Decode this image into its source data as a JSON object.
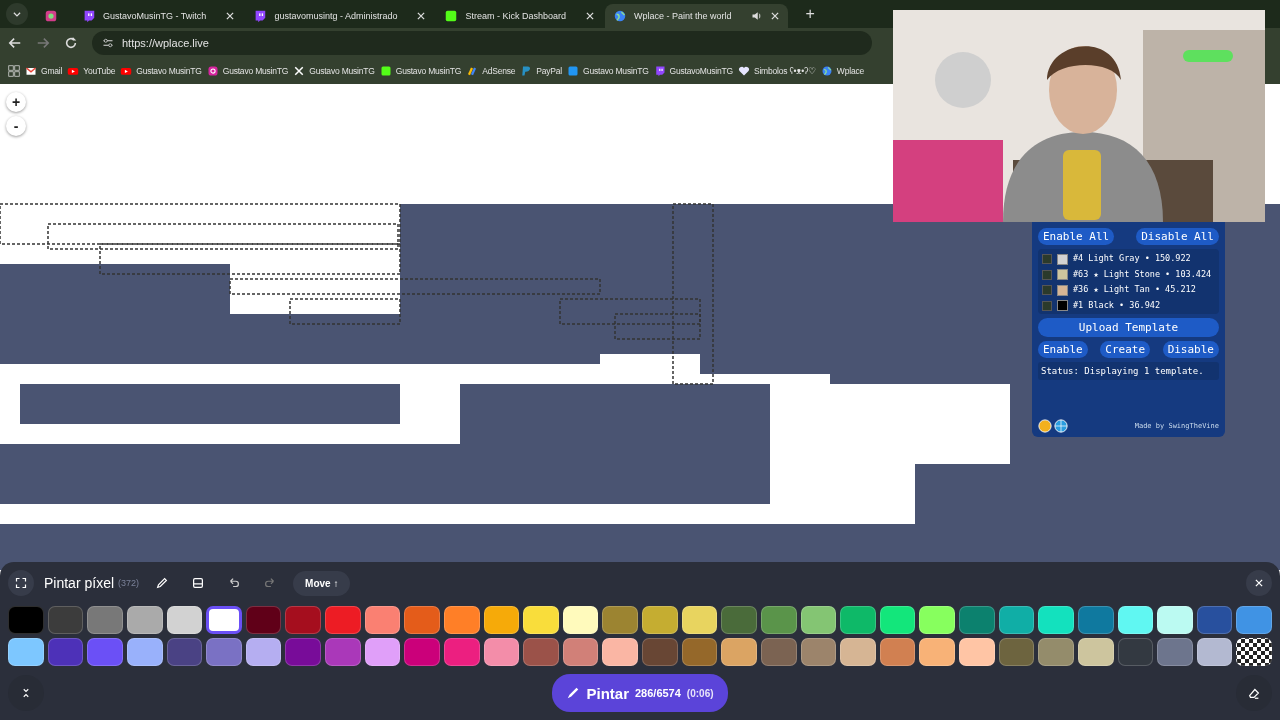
{
  "browser": {
    "tabs": [
      {
        "kind": "app",
        "selected": false
      },
      {
        "label": "GustavoMusinTG - Twitch",
        "kind": "twitch",
        "selected": false
      },
      {
        "label": "gustavomusintg - Administrado",
        "kind": "twitch",
        "selected": false
      },
      {
        "label": "Stream - Kick Dashboard",
        "kind": "kick",
        "selected": false
      },
      {
        "label": "Wplace - Paint the world",
        "kind": "globe",
        "selected": true
      }
    ],
    "new_tab": "+",
    "address": "https://wplace.live",
    "bookmarks": [
      {
        "label": "Gmail",
        "kind": "gmail"
      },
      {
        "label": "YouTube",
        "kind": "youtube"
      },
      {
        "label": "Gustavo MusinTG",
        "kind": "youtube"
      },
      {
        "label": "Gustavo MusinTG",
        "kind": "instagram"
      },
      {
        "label": "Gustavo MusinTG",
        "kind": "x"
      },
      {
        "label": "Gustavo MusinTG",
        "kind": "kick"
      },
      {
        "label": "AdSense",
        "kind": "adsense"
      },
      {
        "label": "PayPal",
        "kind": "paypal"
      },
      {
        "label": "Gustavo MusinTG",
        "kind": "square"
      },
      {
        "label": "GustavoMusinTG",
        "kind": "twitch"
      },
      {
        "label": "Simbolos ʕ•ᴥ•ʔ♡",
        "kind": "heart"
      },
      {
        "label": "Wplace",
        "kind": "globe"
      }
    ]
  },
  "map": {
    "zoom_in": "+",
    "zoom_out": "-"
  },
  "template_panel": {
    "top_buttons": [
      "Enable All",
      "Disable All"
    ],
    "colors": [
      {
        "label": "#4 Light Gray • 150.922",
        "color": "#d2d2d2",
        "checked": false
      },
      {
        "label": "#63 ★ Light Stone • 103.424",
        "color": "#cdc59e",
        "checked": false
      },
      {
        "label": "#36 ★ Light Tan • 45.212",
        "color": "#d6b594",
        "checked": false
      },
      {
        "label": "#1 Black • 36.942",
        "color": "#000000",
        "checked": false
      }
    ],
    "upload": "Upload Template",
    "actions": [
      "Enable",
      "Create",
      "Disable"
    ],
    "status": "Status: Displaying 1 template.",
    "credit": "Made by SwingTheVine"
  },
  "paint_bar": {
    "title": "Pintar píxel",
    "count": "(372)",
    "move": "Move ↑",
    "palette": [
      {
        "color": "#000000",
        "selected": false
      },
      {
        "color": "#3c3c3c",
        "selected": false
      },
      {
        "color": "#787878",
        "selected": false
      },
      {
        "color": "#aaaaaa",
        "selected": false
      },
      {
        "color": "#d2d2d2",
        "selected": false
      },
      {
        "color": "#ffffff",
        "selected": true
      },
      {
        "color": "#600018",
        "selected": false
      },
      {
        "color": "#a50e1e",
        "selected": false
      },
      {
        "color": "#ed1c24",
        "selected": false
      },
      {
        "color": "#fa8072",
        "selected": false
      },
      {
        "color": "#e45c1a",
        "selected": false
      },
      {
        "color": "#ff7f27",
        "selected": false
      },
      {
        "color": "#f6aa09",
        "selected": false
      },
      {
        "color": "#f9dd3b",
        "selected": false
      },
      {
        "color": "#fffabc",
        "selected": false
      },
      {
        "color": "#9c8431",
        "selected": false
      },
      {
        "color": "#c5ad31",
        "selected": false
      },
      {
        "color": "#e8d45f",
        "selected": false
      },
      {
        "color": "#4a6b3a",
        "selected": false
      },
      {
        "color": "#5a944a",
        "selected": false
      },
      {
        "color": "#84c573",
        "selected": false
      },
      {
        "color": "#0eb968",
        "selected": false
      },
      {
        "color": "#13e67b",
        "selected": false
      },
      {
        "color": "#87ff5e",
        "selected": false
      },
      {
        "color": "#0c816e",
        "selected": false
      },
      {
        "color": "#10aea6",
        "selected": false
      },
      {
        "color": "#13e1be",
        "selected": false
      },
      {
        "color": "#0f799f",
        "selected": false
      },
      {
        "color": "#60f7f2",
        "selected": false
      },
      {
        "color": "#bbfaf2",
        "selected": false
      },
      {
        "color": "#28509e",
        "selected": false
      },
      {
        "color": "#4093e4",
        "selected": false
      },
      {
        "color": "#7dc7ff",
        "selected": false
      },
      {
        "color": "#4d31b8",
        "selected": false
      },
      {
        "color": "#6b50f6",
        "selected": false
      },
      {
        "color": "#99b1fb",
        "selected": false
      },
      {
        "color": "#4a4284",
        "selected": false
      },
      {
        "color": "#7a71c4",
        "selected": false
      },
      {
        "color": "#b5aef1",
        "selected": false
      },
      {
        "color": "#780c99",
        "selected": false
      },
      {
        "color": "#aa38b9",
        "selected": false
      },
      {
        "color": "#e09ff9",
        "selected": false
      },
      {
        "color": "#cb007a",
        "selected": false
      },
      {
        "color": "#ec1f80",
        "selected": false
      },
      {
        "color": "#f38da9",
        "selected": false
      },
      {
        "color": "#9b5249",
        "selected": false
      },
      {
        "color": "#d18078",
        "selected": false
      },
      {
        "color": "#fab6a4",
        "selected": false
      },
      {
        "color": "#684634",
        "selected": false
      },
      {
        "color": "#95682a",
        "selected": false
      },
      {
        "color": "#dba463",
        "selected": false
      },
      {
        "color": "#7b6352",
        "selected": false
      },
      {
        "color": "#9c846b",
        "selected": false
      },
      {
        "color": "#d6b594",
        "selected": false
      },
      {
        "color": "#d18051",
        "selected": false
      },
      {
        "color": "#f8b277",
        "selected": false
      },
      {
        "color": "#ffc5a5",
        "selected": false
      },
      {
        "color": "#6d643f",
        "selected": false
      },
      {
        "color": "#948c6b",
        "selected": false
      },
      {
        "color": "#cdc59e",
        "selected": false
      },
      {
        "color": "#333941",
        "selected": false
      },
      {
        "color": "#6d758d",
        "selected": false
      },
      {
        "color": "#b3b9d1",
        "selected": false
      },
      {
        "kind": "transparent",
        "selected": false
      }
    ],
    "paint_button": {
      "label": "Pintar",
      "progress": "286/6574",
      "timer": "(0:06)"
    }
  }
}
